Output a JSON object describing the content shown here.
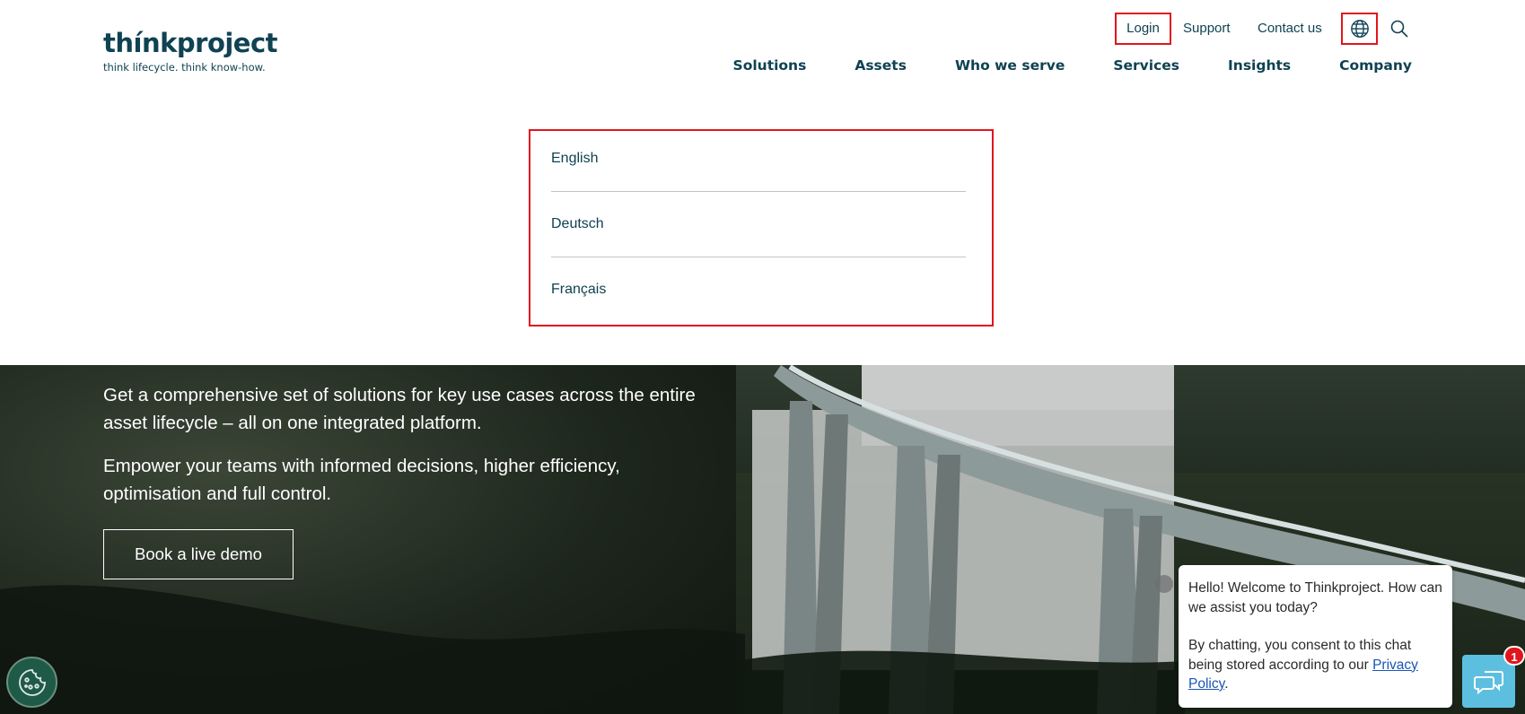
{
  "header": {
    "logo_word": "thínkproject",
    "logo_tagline": "think lifecycle. think know-how.",
    "utility": {
      "login": "Login",
      "support": "Support",
      "contact": "Contact us",
      "globe_icon": "globe-icon",
      "search_icon": "search-icon"
    },
    "nav": [
      "Solutions",
      "Assets",
      "Who we serve",
      "Services",
      "Insights",
      "Company"
    ]
  },
  "language_menu": {
    "items": [
      "English",
      "Deutsch",
      "Français"
    ]
  },
  "hero": {
    "paragraph1": "Get a comprehensive set of solutions for key use cases across the entire asset lifecycle – all on one integrated platform.",
    "paragraph2": "Empower your teams with informed decisions, higher efficiency, optimisation and full control.",
    "cta": "Book a live demo"
  },
  "chat": {
    "greeting": "Hello! Welcome to Thinkproject. How can we assist you today?",
    "consent_prefix": "By chatting, you consent to this chat being stored according to our ",
    "privacy_link": "Privacy Policy",
    "consent_suffix": ".",
    "badge_count": "1"
  },
  "colors": {
    "brand": "#0f4252",
    "highlight": "#e0161c",
    "chat_launcher": "#5dbfe0",
    "cookie_button": "#1f5a48"
  }
}
